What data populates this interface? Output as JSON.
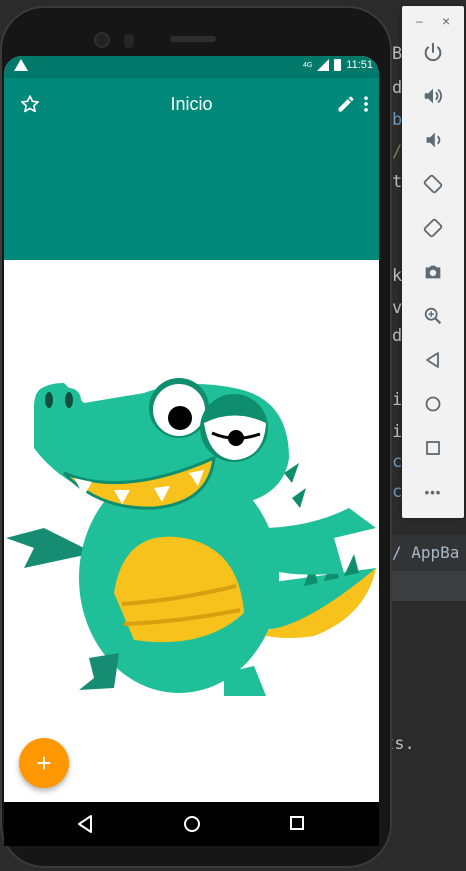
{
  "ide": {
    "fragments": [
      "B",
      "d",
      "b",
      "/",
      "t",
      "",
      "k",
      "v",
      "d",
      "",
      "i",
      "i",
      "c",
      "c"
    ],
    "breadcrumb": "/ AppBa",
    "console_text": "ts."
  },
  "app": {
    "title": "Inicio",
    "status_time": "11:51",
    "status_network": "4G",
    "fab_label": "+"
  },
  "emulator_panel": {
    "window_min": "–",
    "window_close": "×",
    "buttons": [
      "power",
      "volume-up",
      "volume-down",
      "rotate-left",
      "rotate-right",
      "screenshot",
      "zoom",
      "back",
      "home",
      "overview",
      "more"
    ],
    "more_label": "•••"
  },
  "colors": {
    "status_bar": "#00796b",
    "app_bar": "#00897b",
    "fab": "#ff9800",
    "croc_green": "#1fbf9a",
    "croc_dark": "#0e8e6d",
    "croc_yellow": "#f6c21b"
  }
}
